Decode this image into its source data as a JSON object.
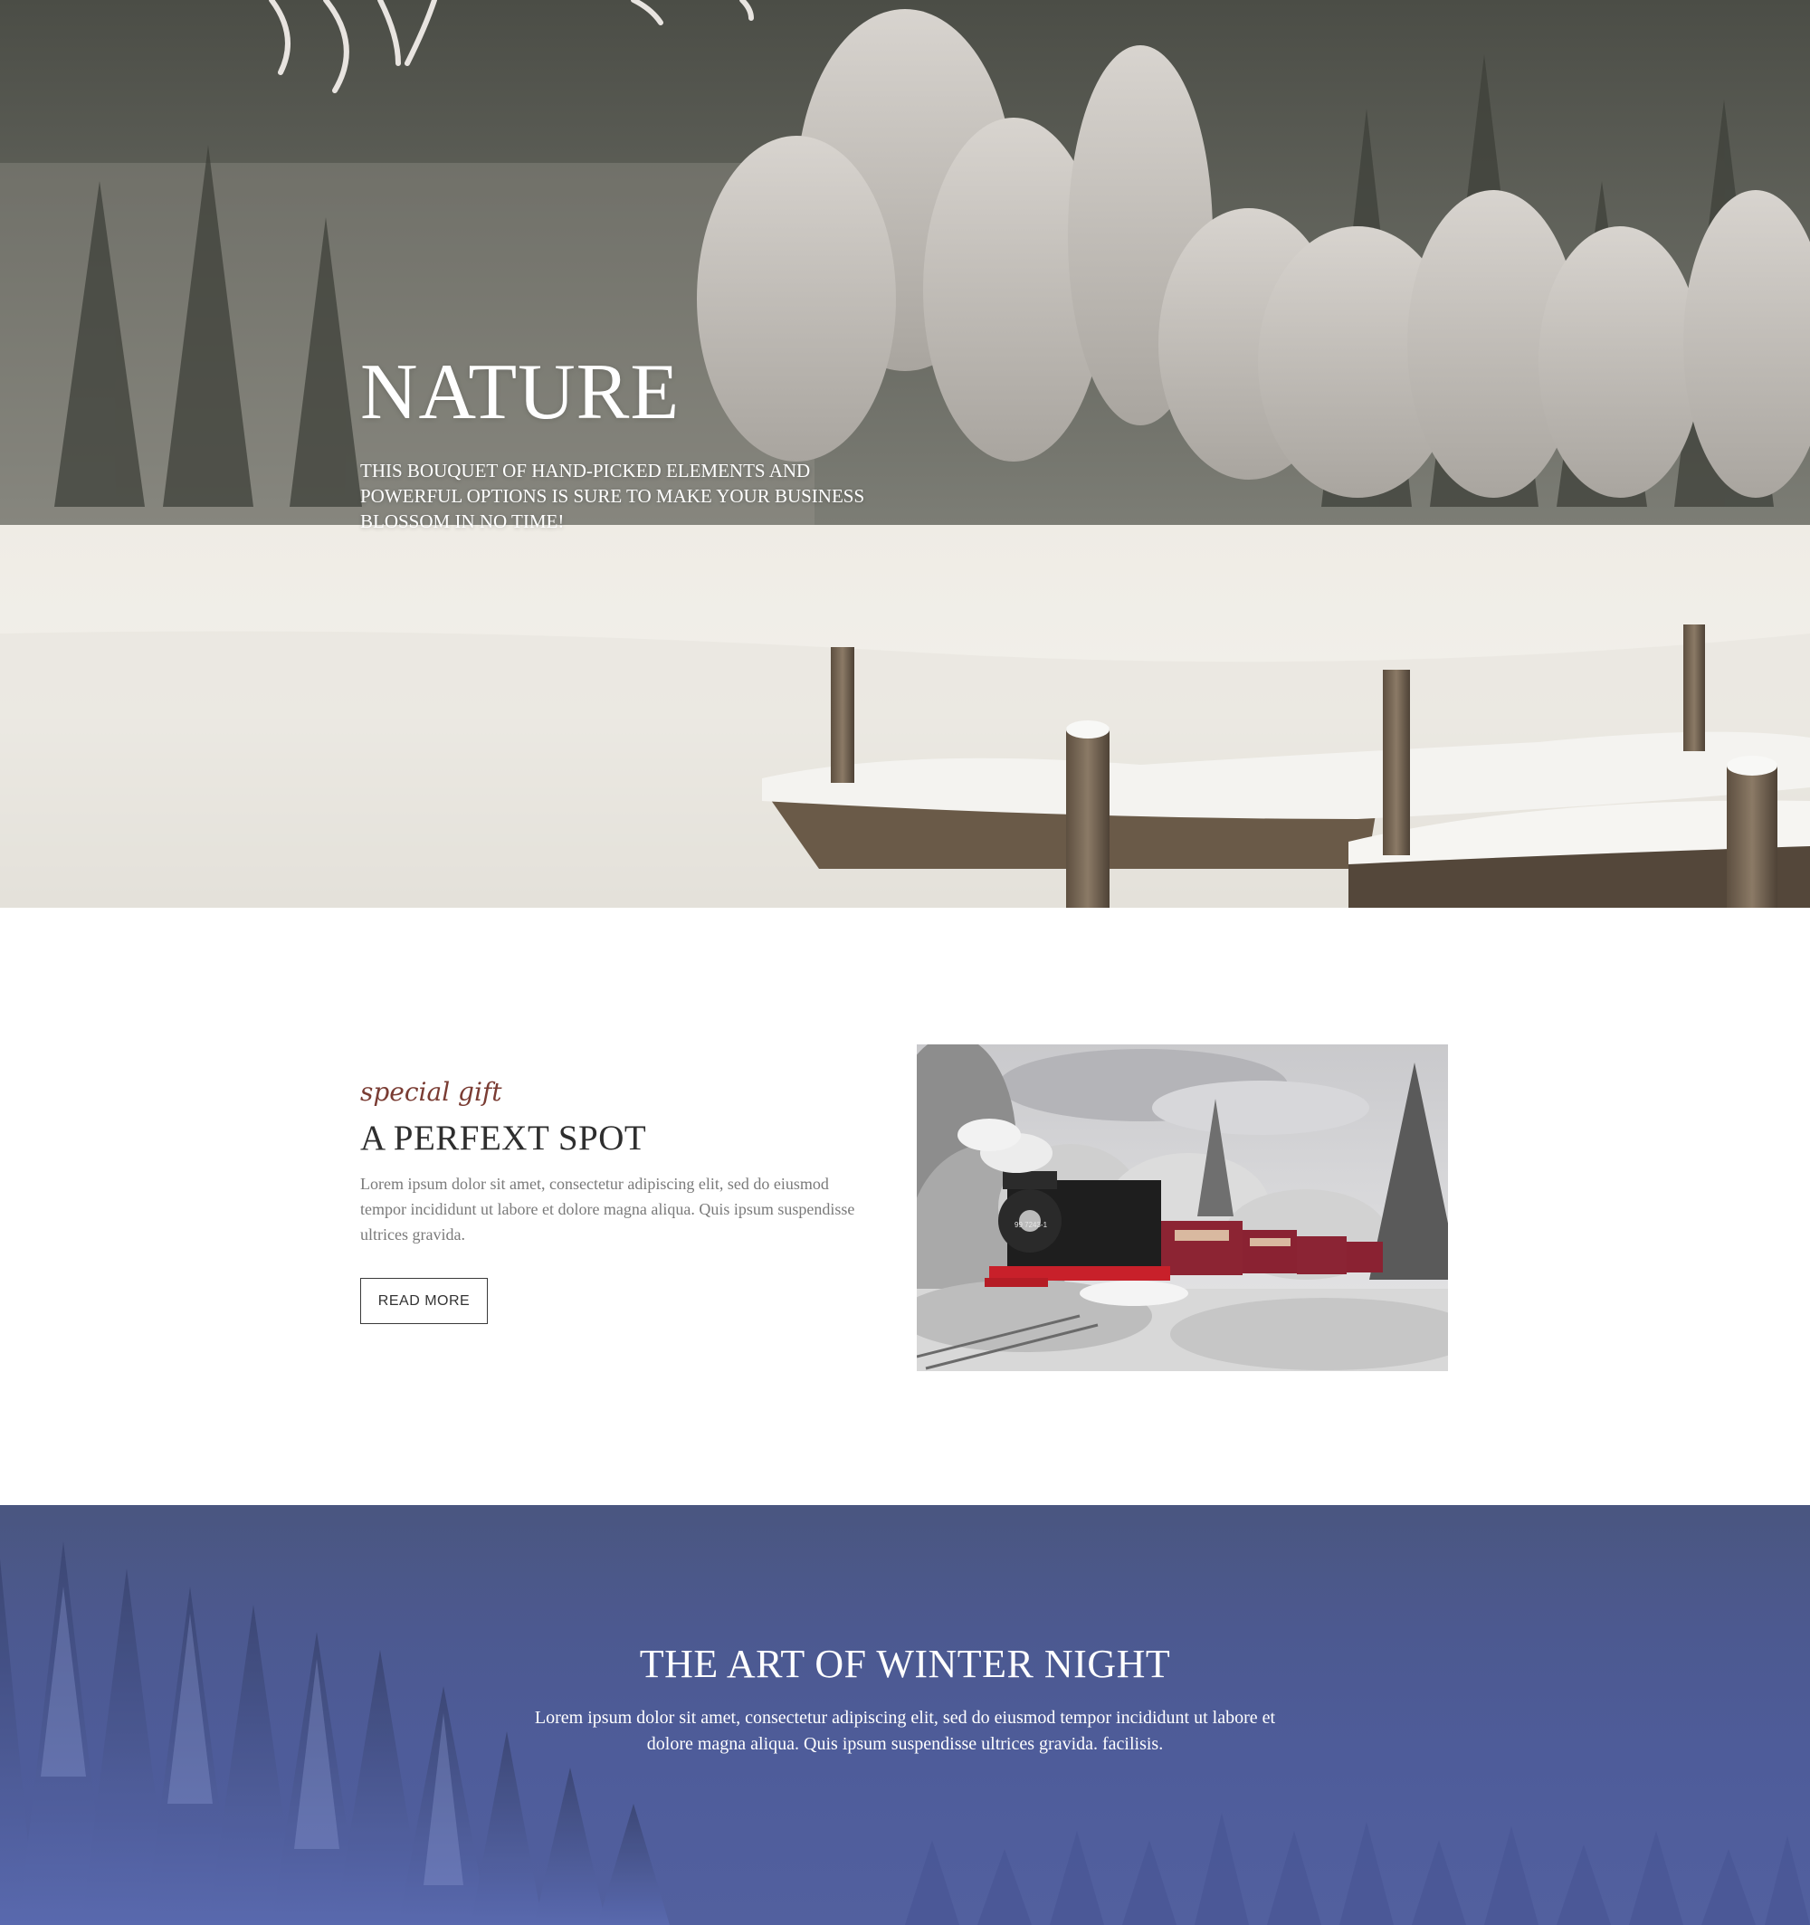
{
  "hero": {
    "title": "NATURE",
    "subtitle": "THIS BOUQUET OF HAND-PICKED ELEMENTS AND POWERFUL OPTIONS IS SURE TO MAKE YOUR BUSINESS BLOSSOM IN NO TIME!",
    "image": "winter-lake-pier-photo"
  },
  "feature": {
    "eyebrow": "special gift",
    "title": "A PERFEXT SPOT",
    "body": "Lorem ipsum dolor sit amet, consectetur adipiscing elit, sed do eiusmod tempor incididunt ut labore et dolore magna aliqua. Quis ipsum suspendisse ultrices gravida.",
    "button_label": "READ MORE",
    "image": "steam-train-winter-photo",
    "locomotive_plate": "99 7243-1"
  },
  "night": {
    "title": "THE ART OF WINTER NIGHT",
    "body": "Lorem ipsum dolor sit amet, consectetur adipiscing elit, sed do eiusmod tempor incididunt ut labore et dolore magna aliqua. Quis ipsum suspendisse ultrices gravida. facilisis.",
    "image": "snowy-forest-night-photo"
  },
  "colors": {
    "eyebrow": "#7a3c33",
    "night_background": "#4e5c9a",
    "body_text": "#7a7a7a",
    "heading_dark": "#2e2e2e"
  }
}
